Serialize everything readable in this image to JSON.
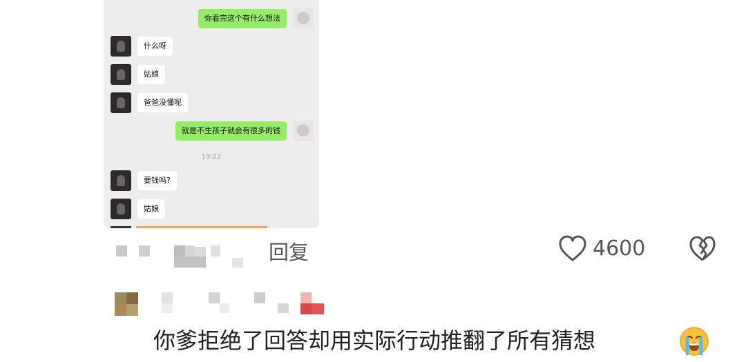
{
  "chat": {
    "messages": [
      {
        "side": "out",
        "text": "你看完这个有什么想法"
      },
      {
        "side": "in",
        "text": "什么呀"
      },
      {
        "side": "in",
        "text": "姑娘"
      },
      {
        "side": "in",
        "text": "爸爸没懂呢"
      },
      {
        "side": "out",
        "text": "就是不生孩子就会有很多的钱"
      },
      {
        "side": "in",
        "text": "要钱吗?"
      },
      {
        "side": "in",
        "text": "姑娘"
      }
    ],
    "timestamp": "19:22"
  },
  "actions": {
    "reply_label": "回复",
    "like_count": "4600"
  },
  "comment": {
    "text": "你爹拒绝了回答却用实际行动推翻了所有猜想",
    "emoji": "loudly-crying-face"
  },
  "colors": {
    "chat_bg": "#ededed",
    "outgoing_bubble": "#95ec69",
    "incoming_bubble": "#ffffff",
    "icon_gray": "#555555"
  }
}
